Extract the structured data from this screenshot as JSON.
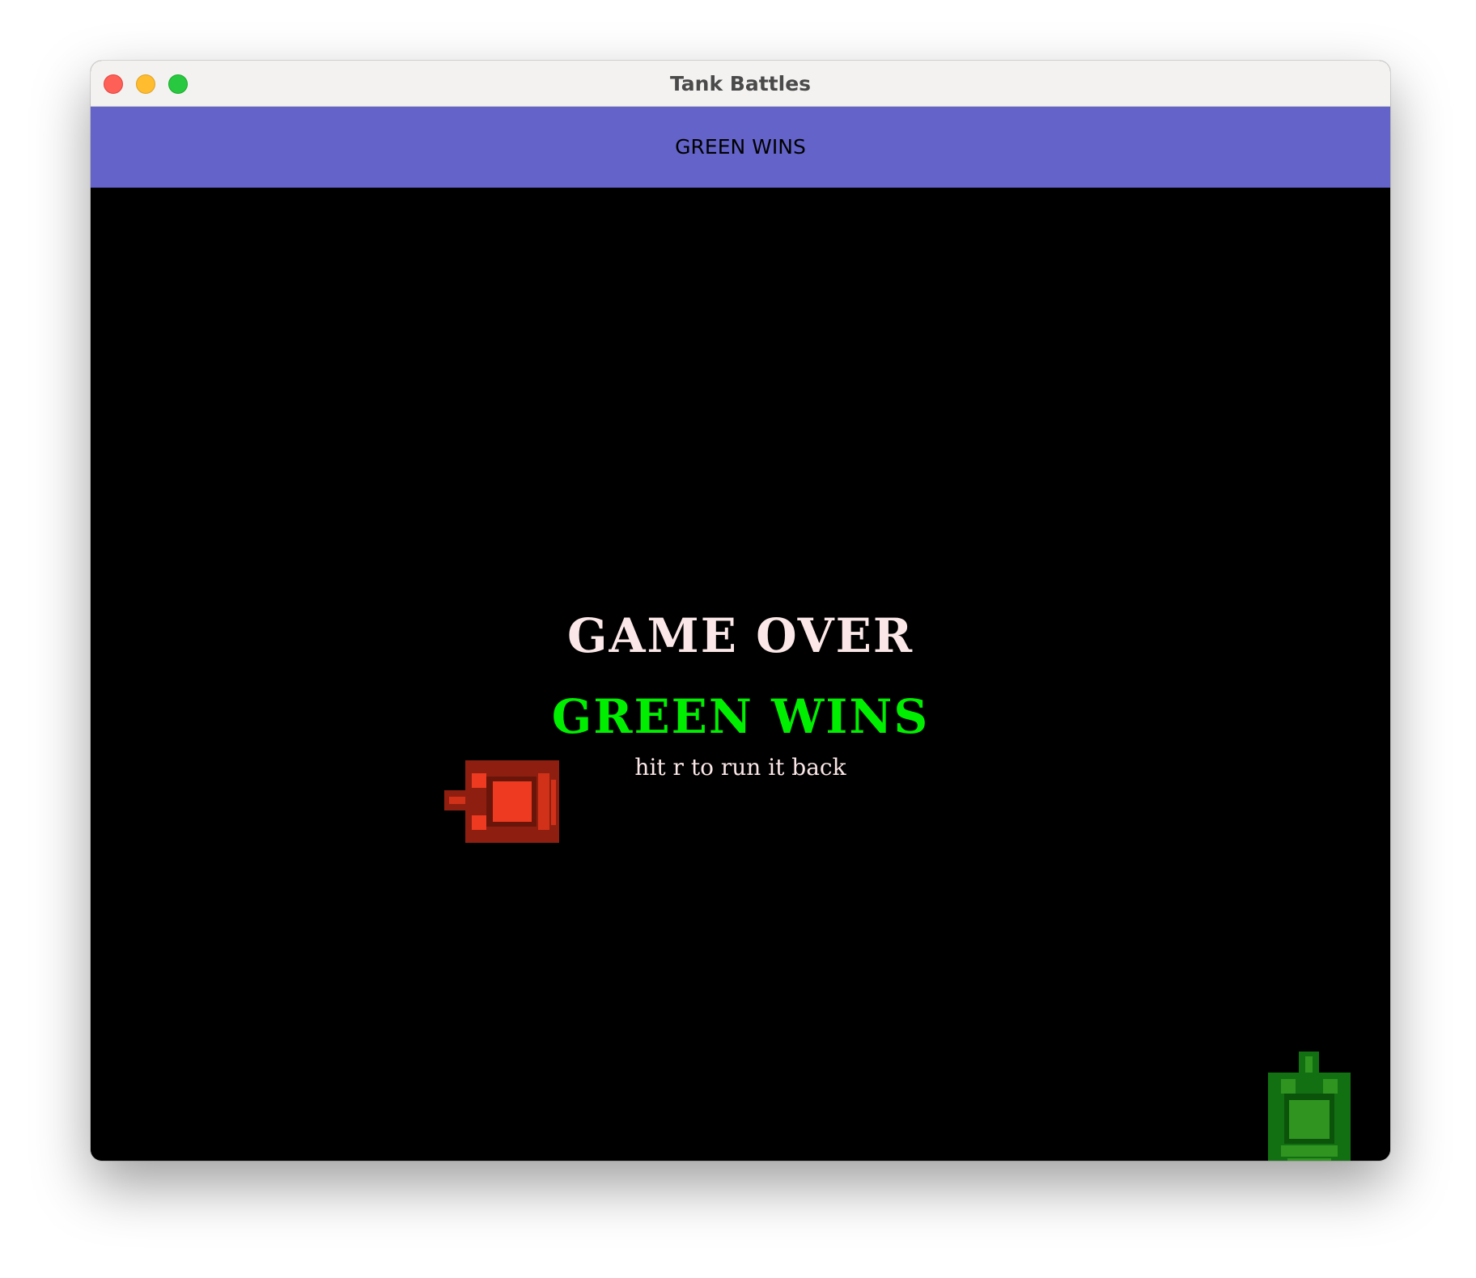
{
  "window": {
    "title": "Tank Battles"
  },
  "status_bar": {
    "text": "GREEN WINS"
  },
  "game": {
    "game_over_text": "GAME OVER",
    "winner_text": "GREEN WINS",
    "hint_text": "hit r to run it back",
    "colors": {
      "background": "#000000",
      "status_bar": "#6363c9",
      "game_over": "#fbe7e7",
      "winner": "#00ee00",
      "red_tank_body": "#8e1f10",
      "red_tank_core": "#ee3a20",
      "green_tank_body": "#127012",
      "green_tank_core": "#2f9420"
    },
    "tanks": [
      {
        "name": "red",
        "facing": "left"
      },
      {
        "name": "green",
        "facing": "up"
      }
    ]
  }
}
